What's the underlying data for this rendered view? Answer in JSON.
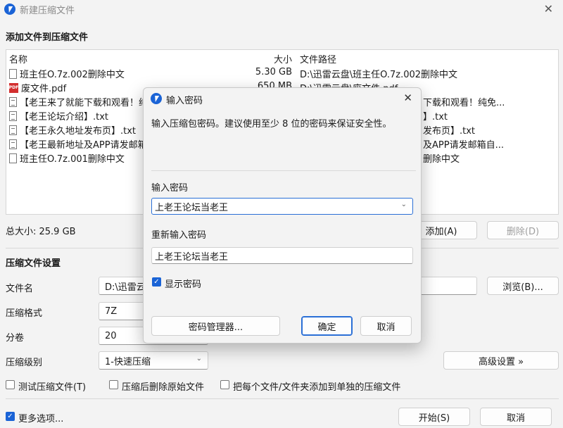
{
  "window": {
    "title": "新建压缩文件",
    "close_glyph": "✕"
  },
  "add_section": {
    "title": "添加文件到压缩文件"
  },
  "file_list": {
    "columns": {
      "name": "名称",
      "size": "大小",
      "path": "文件路径"
    },
    "rows": [
      {
        "icon": "text-file-icon",
        "name": "班主任O.7z.002删除中文",
        "size": "5.30 GB",
        "path": "D:\\迅雷云盘\\班主任O.7z.002删除中文"
      },
      {
        "icon": "pdf-file-icon",
        "name": "废文件.pdf",
        "size": "650 MB",
        "path": "D:\\迅雷云盘\\废文件.pdf"
      },
      {
        "icon": "text-file-icon",
        "name": "【老王来了就能下载和观看！纯",
        "size": "",
        "path": "下载和观看！纯免..."
      },
      {
        "icon": "text-file-icon",
        "name": "【老王论坛介绍】.txt",
        "size": "",
        "path": "】.txt"
      },
      {
        "icon": "text-file-icon",
        "name": "【老王永久地址发布页】.txt",
        "size": "",
        "path": "发布页】.txt"
      },
      {
        "icon": "text-file-icon",
        "name": "【老王最新地址及APP请发邮箱",
        "size": "",
        "path": "及APP请发邮箱自..."
      },
      {
        "icon": "text-file-icon",
        "name": "班主任O.7z.001删除中文",
        "size": "",
        "path": "删除中文"
      }
    ]
  },
  "total_size": "总大小: 25.9 GB",
  "buttons": {
    "add": "添加(A)",
    "delete": "删除(D)",
    "browse": "浏览(B)...",
    "advanced": "高级设置 »",
    "start": "开始(S)",
    "cancel": "取消"
  },
  "settings": {
    "title": "压缩文件设置",
    "filename_label": "文件名",
    "filename_value": "D:\\迅雷云",
    "format_label": "压缩格式",
    "format_value": "7Z",
    "volume_label": "分卷",
    "volume_value": "20",
    "level_label": "压缩级别",
    "level_value": "1-快速压缩"
  },
  "options": {
    "test": "测试压缩文件(T)",
    "delete_after": "压缩后删除原始文件",
    "each_separate": "把每个文件/文件夹添加到单独的压缩文件",
    "more": "更多选项..."
  },
  "dialog": {
    "title": "输入密码",
    "close_glyph": "✕",
    "description": "输入压缩包密码。建议使用至少 8 位的密码来保证安全性。",
    "password_label": "输入密码",
    "password_value": "上老王论坛当老王",
    "confirm_label": "重新输入密码",
    "confirm_value": "上老王论坛当老王",
    "show_password": "显示密码",
    "manager_button": "密码管理器...",
    "ok_button": "确定",
    "cancel_button": "取消"
  },
  "colors": {
    "accent": "#1a63d6",
    "pdf": "#d32f2f"
  }
}
